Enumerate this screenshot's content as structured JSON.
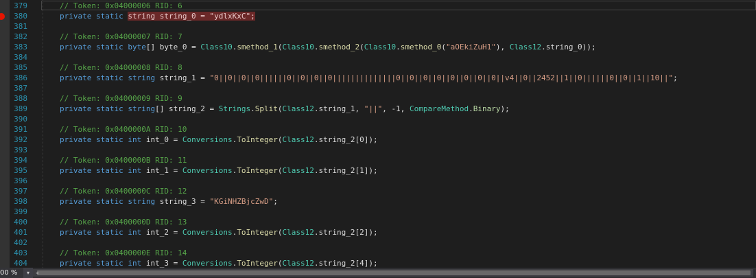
{
  "editor": {
    "breakpoint_line": "381",
    "lines": [
      {
        "n": "379",
        "tokens": [
          {
            "t": "// Token: 0x04000006 RID: 6",
            "c": "comment"
          }
        ]
      },
      {
        "n": "380",
        "tokens": [
          {
            "t": "private static ",
            "c": "kw"
          },
          {
            "t": "string string_0 = \"ydlxKxC\";",
            "c": "hl"
          }
        ]
      },
      {
        "n": "381",
        "tokens": []
      },
      {
        "n": "382",
        "tokens": [
          {
            "t": "// Token: 0x04000007 RID: 7",
            "c": "comment"
          }
        ]
      },
      {
        "n": "383",
        "tokens": [
          {
            "t": "private static byte",
            "c": "kw"
          },
          {
            "t": "[] byte_0 = ",
            "c": "def"
          },
          {
            "t": "Class10",
            "c": "type"
          },
          {
            "t": ".",
            "c": "def"
          },
          {
            "t": "smethod_1",
            "c": "method"
          },
          {
            "t": "(",
            "c": "def"
          },
          {
            "t": "Class10",
            "c": "type"
          },
          {
            "t": ".",
            "c": "def"
          },
          {
            "t": "smethod_2",
            "c": "method"
          },
          {
            "t": "(",
            "c": "def"
          },
          {
            "t": "Class10",
            "c": "type"
          },
          {
            "t": ".",
            "c": "def"
          },
          {
            "t": "smethod_0",
            "c": "method"
          },
          {
            "t": "(",
            "c": "def"
          },
          {
            "t": "\"aOEkiZuH1\"",
            "c": "str"
          },
          {
            "t": "), ",
            "c": "def"
          },
          {
            "t": "Class12",
            "c": "type"
          },
          {
            "t": ".string_0));",
            "c": "def"
          }
        ]
      },
      {
        "n": "384",
        "tokens": []
      },
      {
        "n": "385",
        "tokens": [
          {
            "t": "// Token: 0x04000008 RID: 8",
            "c": "comment"
          }
        ]
      },
      {
        "n": "386",
        "tokens": [
          {
            "t": "private static string ",
            "c": "kw"
          },
          {
            "t": "string_1 = ",
            "c": "def"
          },
          {
            "t": "\"0||0||0||0||||||0||0||0||0||||||||||||||0||0||0||0||0||0||0||0||v4||0||2452||1||0||||||0||0||1||10||\"",
            "c": "str"
          },
          {
            "t": ";",
            "c": "def"
          }
        ]
      },
      {
        "n": "387",
        "tokens": []
      },
      {
        "n": "388",
        "tokens": [
          {
            "t": "// Token: 0x04000009 RID: 9",
            "c": "comment"
          }
        ]
      },
      {
        "n": "389",
        "tokens": [
          {
            "t": "private static string",
            "c": "kw"
          },
          {
            "t": "[] string_2 = ",
            "c": "def"
          },
          {
            "t": "Strings",
            "c": "type"
          },
          {
            "t": ".",
            "c": "def"
          },
          {
            "t": "Split",
            "c": "method"
          },
          {
            "t": "(",
            "c": "def"
          },
          {
            "t": "Class12",
            "c": "type"
          },
          {
            "t": ".string_1, ",
            "c": "def"
          },
          {
            "t": "\"||\"",
            "c": "str"
          },
          {
            "t": ", -1, ",
            "c": "def"
          },
          {
            "t": "CompareMethod",
            "c": "type"
          },
          {
            "t": ".",
            "c": "def"
          },
          {
            "t": "Binary",
            "c": "enum"
          },
          {
            "t": ");",
            "c": "def"
          }
        ]
      },
      {
        "n": "390",
        "tokens": []
      },
      {
        "n": "391",
        "tokens": [
          {
            "t": "// Token: 0x0400000A RID: 10",
            "c": "comment"
          }
        ]
      },
      {
        "n": "392",
        "tokens": [
          {
            "t": "private static int ",
            "c": "kw"
          },
          {
            "t": "int_0 = ",
            "c": "def"
          },
          {
            "t": "Conversions",
            "c": "type"
          },
          {
            "t": ".",
            "c": "def"
          },
          {
            "t": "ToInteger",
            "c": "method"
          },
          {
            "t": "(",
            "c": "def"
          },
          {
            "t": "Class12",
            "c": "type"
          },
          {
            "t": ".string_2[0]);",
            "c": "def"
          }
        ]
      },
      {
        "n": "393",
        "tokens": []
      },
      {
        "n": "394",
        "tokens": [
          {
            "t": "// Token: 0x0400000B RID: 11",
            "c": "comment"
          }
        ]
      },
      {
        "n": "395",
        "tokens": [
          {
            "t": "private static int ",
            "c": "kw"
          },
          {
            "t": "int_1 = ",
            "c": "def"
          },
          {
            "t": "Conversions",
            "c": "type"
          },
          {
            "t": ".",
            "c": "def"
          },
          {
            "t": "ToInteger",
            "c": "method"
          },
          {
            "t": "(",
            "c": "def"
          },
          {
            "t": "Class12",
            "c": "type"
          },
          {
            "t": ".string_2[1]);",
            "c": "def"
          }
        ]
      },
      {
        "n": "396",
        "tokens": []
      },
      {
        "n": "397",
        "tokens": [
          {
            "t": "// Token: 0x0400000C RID: 12",
            "c": "comment"
          }
        ]
      },
      {
        "n": "398",
        "tokens": [
          {
            "t": "private static string ",
            "c": "kw"
          },
          {
            "t": "string_3 = ",
            "c": "def"
          },
          {
            "t": "\"KGiNHZBjcZwD\"",
            "c": "str"
          },
          {
            "t": ";",
            "c": "def"
          }
        ]
      },
      {
        "n": "399",
        "tokens": []
      },
      {
        "n": "400",
        "tokens": [
          {
            "t": "// Token: 0x0400000D RID: 13",
            "c": "comment"
          }
        ]
      },
      {
        "n": "401",
        "tokens": [
          {
            "t": "private static int ",
            "c": "kw"
          },
          {
            "t": "int_2 = ",
            "c": "def"
          },
          {
            "t": "Conversions",
            "c": "type"
          },
          {
            "t": ".",
            "c": "def"
          },
          {
            "t": "ToInteger",
            "c": "method"
          },
          {
            "t": "(",
            "c": "def"
          },
          {
            "t": "Class12",
            "c": "type"
          },
          {
            "t": ".string_2[2]);",
            "c": "def"
          }
        ]
      },
      {
        "n": "402",
        "tokens": []
      },
      {
        "n": "403",
        "tokens": [
          {
            "t": "// Token: 0x0400000E RID: 14",
            "c": "comment"
          }
        ]
      },
      {
        "n": "404",
        "tokens": [
          {
            "t": "private static int ",
            "c": "kw"
          },
          {
            "t": "int_3 = ",
            "c": "def"
          },
          {
            "t": "Conversions",
            "c": "type"
          },
          {
            "t": ".",
            "c": "def"
          },
          {
            "t": "ToInteger",
            "c": "method"
          },
          {
            "t": "(",
            "c": "def"
          },
          {
            "t": "Class12",
            "c": "type"
          },
          {
            "t": ".string_2[4]);",
            "c": "def"
          }
        ]
      }
    ]
  },
  "statusbar": {
    "zoom_label": "00 %",
    "dropdown_icon": "chevron-down-icon",
    "scroll_left_icon": "arrow-left-icon"
  },
  "colors": {
    "background": "#1e1e1e",
    "line_number": "#2b91af",
    "comment": "#57a64a",
    "keyword": "#569cd6",
    "type": "#4ec9b0",
    "string": "#d69d85",
    "method": "#dcdcaa",
    "breakpoint": "#e51400",
    "highlight": "#6b2828"
  }
}
